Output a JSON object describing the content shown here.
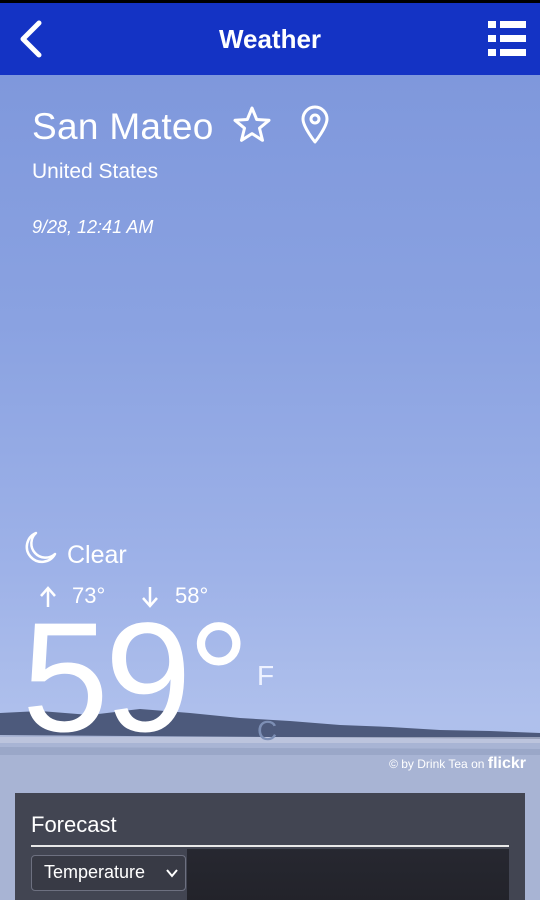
{
  "appbar": {
    "title": "Weather"
  },
  "location": {
    "city": "San Mateo",
    "country": "United States",
    "datetime": "9/28, 12:41 AM"
  },
  "current": {
    "condition": "Clear",
    "high": "73°",
    "low": "58°",
    "temperature": "59°",
    "unit_f": "F",
    "unit_c": "C"
  },
  "credit": {
    "prefix": "© by Drink Tea on ",
    "brand": "flickr"
  },
  "forecast": {
    "title": "Forecast",
    "selected": "Temperature"
  },
  "colors": {
    "appbar": "#1433c4",
    "sky": "#8fa3e0",
    "panel": "#3a3c46"
  }
}
